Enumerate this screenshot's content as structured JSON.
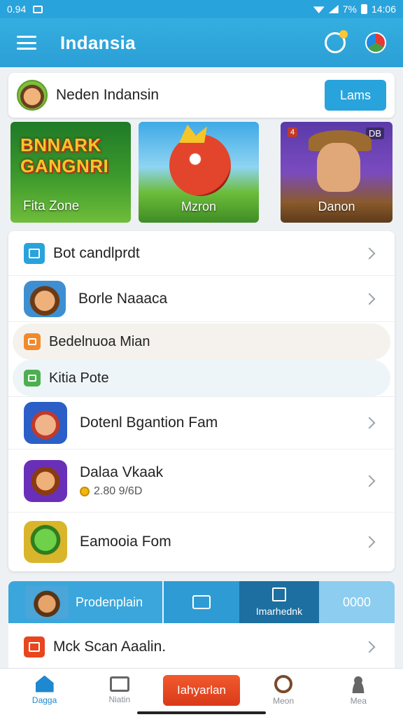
{
  "status_bar": {
    "time_left": "0.94",
    "right_status": "7%",
    "clock": "14:06"
  },
  "app_bar": {
    "title": "Indansia"
  },
  "profile": {
    "name": "Neden Indansin",
    "button_label": "Lams"
  },
  "banners": [
    {
      "headline_line1": "BNNARK",
      "headline_line2": "GANGNRI",
      "caption": "Fita Zone"
    },
    {
      "caption": "Mzron"
    },
    {
      "caption": "Danon",
      "tag_left": "4",
      "tag_right": "DB"
    }
  ],
  "list": {
    "rows": [
      {
        "label": "Bot candlprdt",
        "icon": "list-icon",
        "accent": "#29a3dc"
      },
      {
        "label": "Borle Naaaca",
        "icon": "game-thumb"
      },
      {
        "label": "Bedelnuoa Mian",
        "icon": "square-icon",
        "accent": "#f08a2c"
      },
      {
        "label": "Kitia Pote",
        "icon": "check-square-icon",
        "accent": "#4caf50"
      },
      {
        "label": "Dotenl Bgantion Fam",
        "icon": "game-thumb"
      },
      {
        "label": "Dalaa Vkaak",
        "sub_value": "2.80 9/6D",
        "icon": "game-thumb"
      },
      {
        "label": "Eamooia Fom",
        "icon": "game-thumb"
      }
    ]
  },
  "tabs": [
    {
      "label": "Prodenplain"
    },
    {
      "label": ""
    },
    {
      "label": "Imarhednk"
    },
    {
      "label": "0000"
    }
  ],
  "bottom_row": {
    "label": "Mck Scan Aaalin."
  },
  "nav": [
    {
      "label": "Dagga",
      "icon": "home-icon"
    },
    {
      "label": "Niatin",
      "icon": "grid-icon"
    },
    {
      "label": "Iahyarlan"
    },
    {
      "label": "Meon",
      "icon": "circle-icon"
    },
    {
      "label": "Mea",
      "icon": "user-icon"
    }
  ],
  "colors": {
    "primary": "#29a3dc",
    "accent_cta": "#e8461f",
    "active_nav": "#1e88d0"
  }
}
